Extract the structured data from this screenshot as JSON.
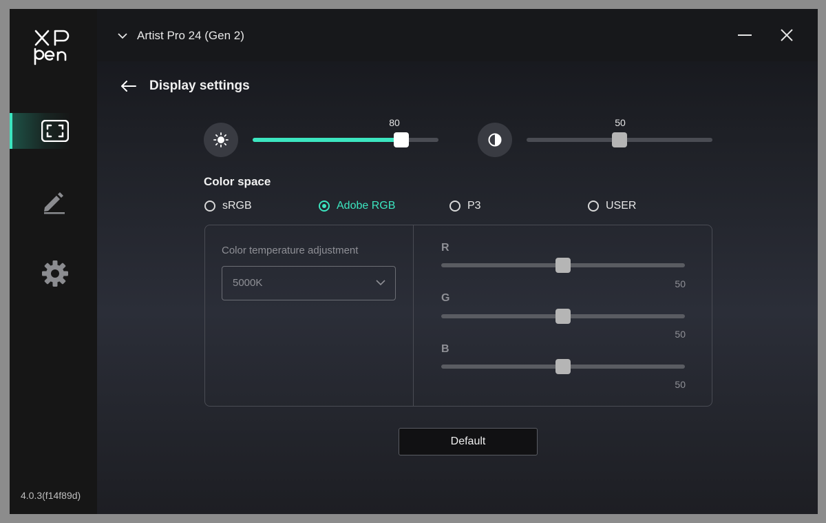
{
  "app": {
    "brand": "XP-Pen",
    "logo_text": [
      "XP",
      "pen"
    ],
    "version": "4.0.3(f14f89d)"
  },
  "sidebar": {
    "items": [
      {
        "icon": "display-icon",
        "active": true
      },
      {
        "icon": "pen-icon",
        "active": false
      },
      {
        "icon": "gear-icon",
        "active": false
      }
    ]
  },
  "titlebar": {
    "device_name": "Artist Pro 24 (Gen 2)"
  },
  "page": {
    "title": "Display settings"
  },
  "brightness": {
    "icon": "sun-icon",
    "value": 80,
    "value_label": "80",
    "max": 100
  },
  "contrast": {
    "icon": "contrast-icon",
    "value": 50,
    "value_label": "50",
    "max": 100
  },
  "color_space": {
    "title": "Color space",
    "options": [
      {
        "label": "sRGB",
        "checked": false
      },
      {
        "label": "Adobe RGB",
        "checked": true
      },
      {
        "label": "P3",
        "checked": false
      },
      {
        "label": "USER",
        "checked": false
      }
    ]
  },
  "temperature": {
    "label": "Color temperature adjustment",
    "value": "5000K"
  },
  "rgb": [
    {
      "label": "R",
      "value": 50,
      "value_label": "50",
      "max": 100
    },
    {
      "label": "G",
      "value": 50,
      "value_label": "50",
      "max": 100
    },
    {
      "label": "B",
      "value": 50,
      "value_label": "50",
      "max": 100
    }
  ],
  "default_button": "Default",
  "colors": {
    "accent": "#3ce6c0",
    "thumb_active": "#ffffff",
    "thumb_disabled": "#b5b5b5"
  }
}
